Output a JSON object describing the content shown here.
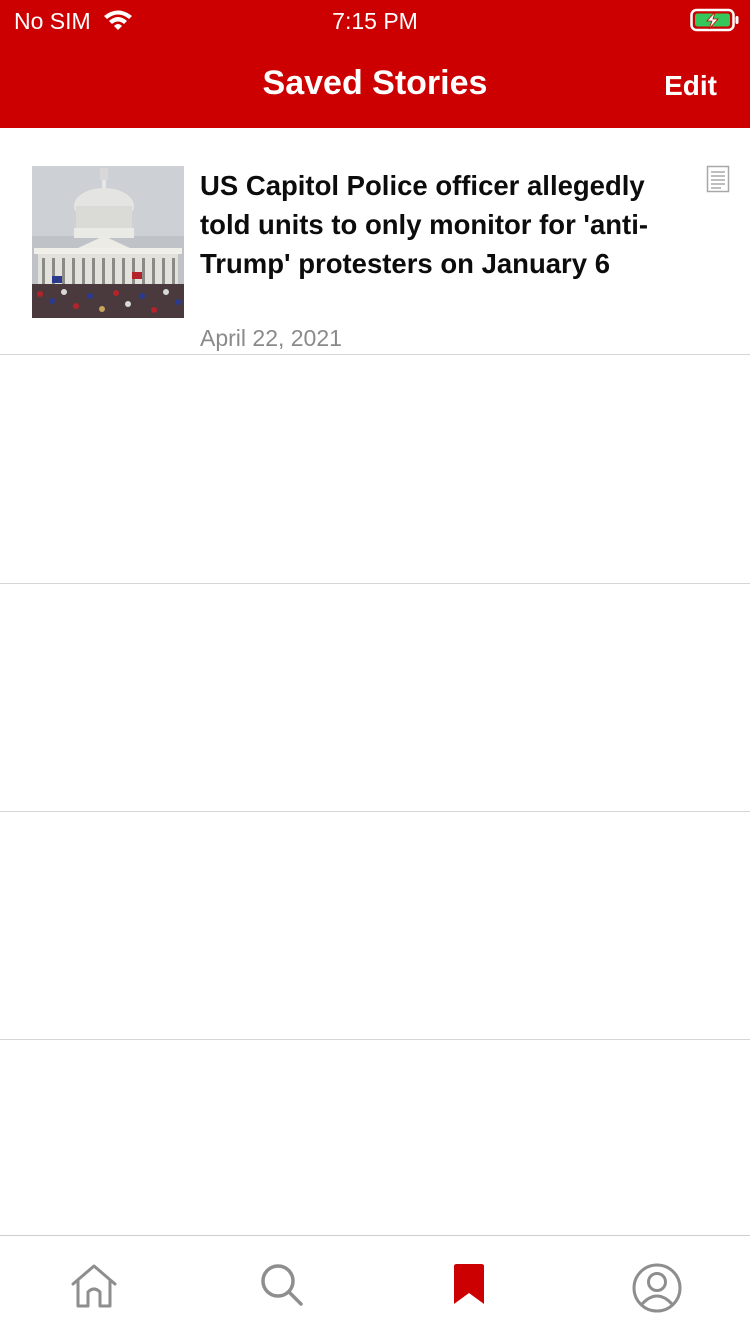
{
  "status_bar": {
    "carrier": "No SIM",
    "time": "7:15 PM",
    "icons": [
      "wifi-icon",
      "battery-charging-icon"
    ]
  },
  "header": {
    "title": "Saved Stories",
    "edit_label": "Edit",
    "background_color": "#cc0000"
  },
  "stories": [
    {
      "headline": "US Capitol Police officer allegedly told units to only monitor for 'anti-Trump' protesters on January 6",
      "date": "April 22, 2021",
      "type_icon": "article-icon",
      "thumbnail": "capitol-building-photo"
    }
  ],
  "tab_bar": {
    "tabs": [
      {
        "icon": "home-icon",
        "active": false
      },
      {
        "icon": "search-icon",
        "active": false
      },
      {
        "icon": "bookmark-icon",
        "active": true
      },
      {
        "icon": "profile-icon",
        "active": false
      }
    ],
    "active_color": "#cc0000",
    "inactive_color": "#8e8e8e"
  }
}
